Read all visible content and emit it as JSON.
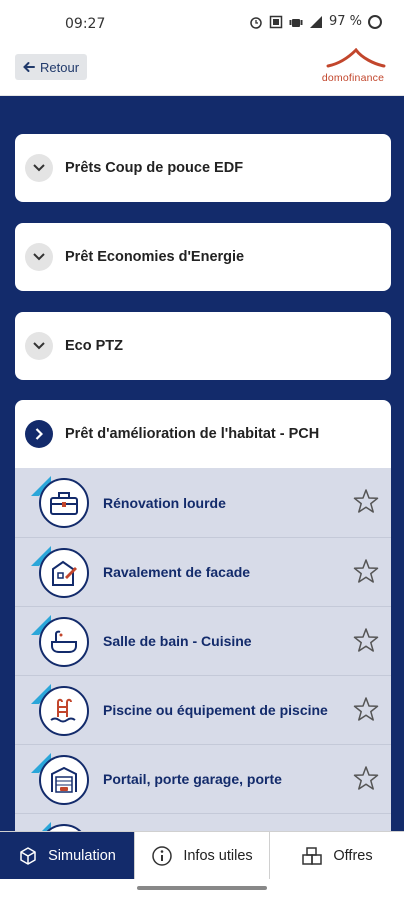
{
  "status_bar": {
    "time": "09:27",
    "battery": "97 %"
  },
  "header": {
    "back_label": "Retour",
    "logo_text": "domofinance"
  },
  "accordion": [
    {
      "title": "Prêts Coup de pouce EDF",
      "expanded": false
    },
    {
      "title": "Prêt Economies d'Energie",
      "expanded": false
    },
    {
      "title": "Eco PTZ",
      "expanded": false
    },
    {
      "title": "Prêt d'amélioration de l'habitat - PCH",
      "expanded": true,
      "items": [
        {
          "label": "Rénovation lourde",
          "icon": "toolbox-icon",
          "ribbon": "EASY"
        },
        {
          "label": "Ravalement de facade",
          "icon": "facade-icon",
          "ribbon": "EASY"
        },
        {
          "label": "Salle de bain - Cuisine",
          "icon": "bathtub-icon",
          "ribbon": "EASY"
        },
        {
          "label": "Piscine ou équipement de piscine",
          "icon": "pool-ladder-icon",
          "ribbon": "EASY"
        },
        {
          "label": "Portail, porte garage, porte",
          "icon": "garage-door-icon",
          "ribbon": "EASY"
        }
      ]
    }
  ],
  "bottom_nav": [
    {
      "label": "Simulation",
      "icon": "cube-icon",
      "active": true
    },
    {
      "label": "Infos utiles",
      "icon": "info-icon",
      "active": false
    },
    {
      "label": "Offres",
      "icon": "boxes-icon",
      "active": false
    }
  ],
  "colors": {
    "navy": "#132b6b",
    "sub_bg": "#d7dbe8",
    "brand": "#c2462c"
  }
}
